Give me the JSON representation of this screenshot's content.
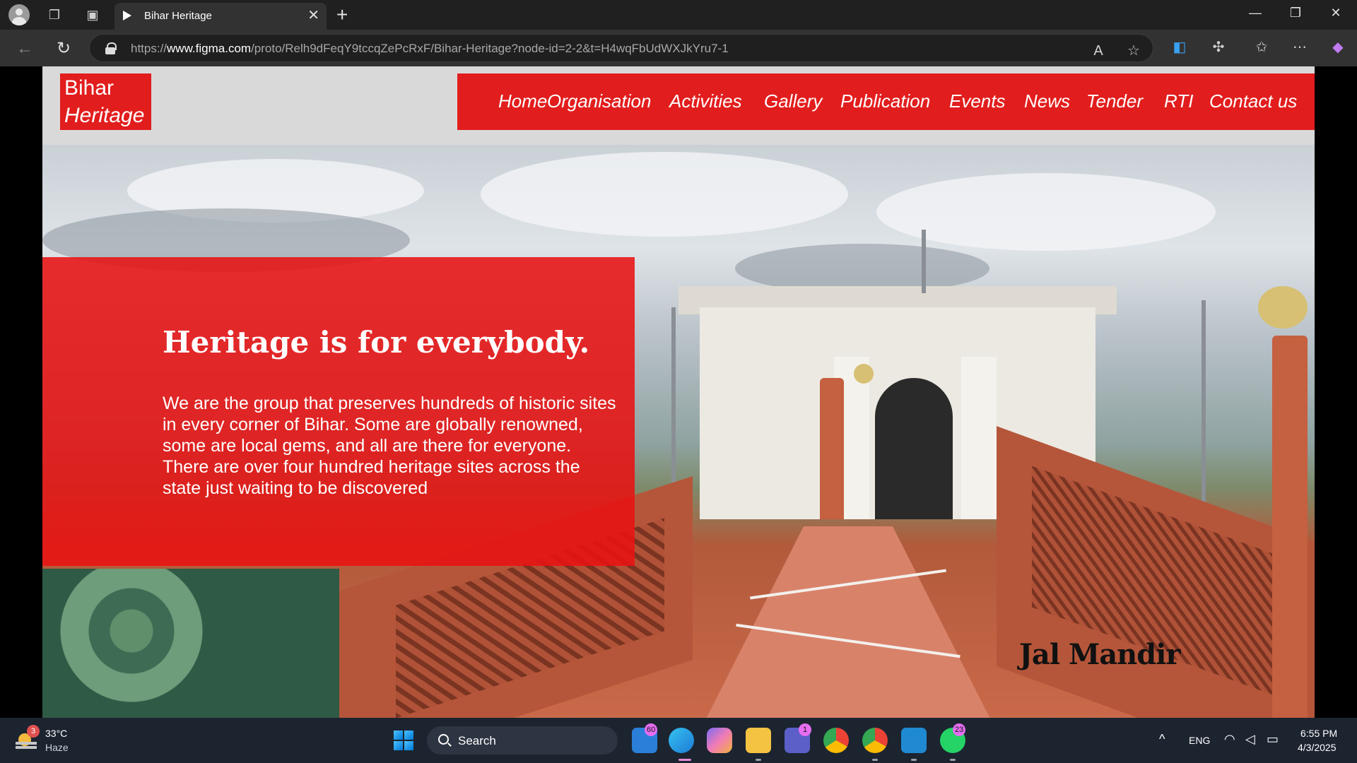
{
  "browser": {
    "tab_title": "Bihar Heritage",
    "url_prefix": "https://",
    "url_domain": "www.figma.com",
    "url_path": "/proto/Relh9dFeqY9tccqZePcRxF/Bihar-Heritage?node-id=2-2&t=H4wqFbUdWXJkYru7-1"
  },
  "site": {
    "logo_line1": "Bihar",
    "logo_line2": "Heritage",
    "nav": [
      "Home",
      "Organisation",
      "Activities",
      "Gallery",
      "Publication",
      "Events",
      "News",
      "Tender",
      "RTI",
      "Contact us"
    ],
    "hero_title": "Heritage is for everybody.",
    "hero_body": "We are the group that preserves hundreds of historic sites in every corner of Bihar. Some are globally renowned, some are local gems, and all are there for everyone. There are over four hundred heritage sites across the state just waiting to be discovered",
    "image_caption": "Jal Mandir"
  },
  "taskbar": {
    "weather_temp": "33°C",
    "weather_desc": "Haze",
    "weather_badge": "3",
    "search_label": "Search",
    "badges": {
      "widgets": "60",
      "teams": "1",
      "whatsapp": "23"
    },
    "language": "ENG",
    "time": "6:55 PM",
    "date": "4/3/2025"
  },
  "colors": {
    "brand_red": "#e21d1d",
    "header_gray": "#d9d9d9",
    "browser_dark": "#202020"
  }
}
